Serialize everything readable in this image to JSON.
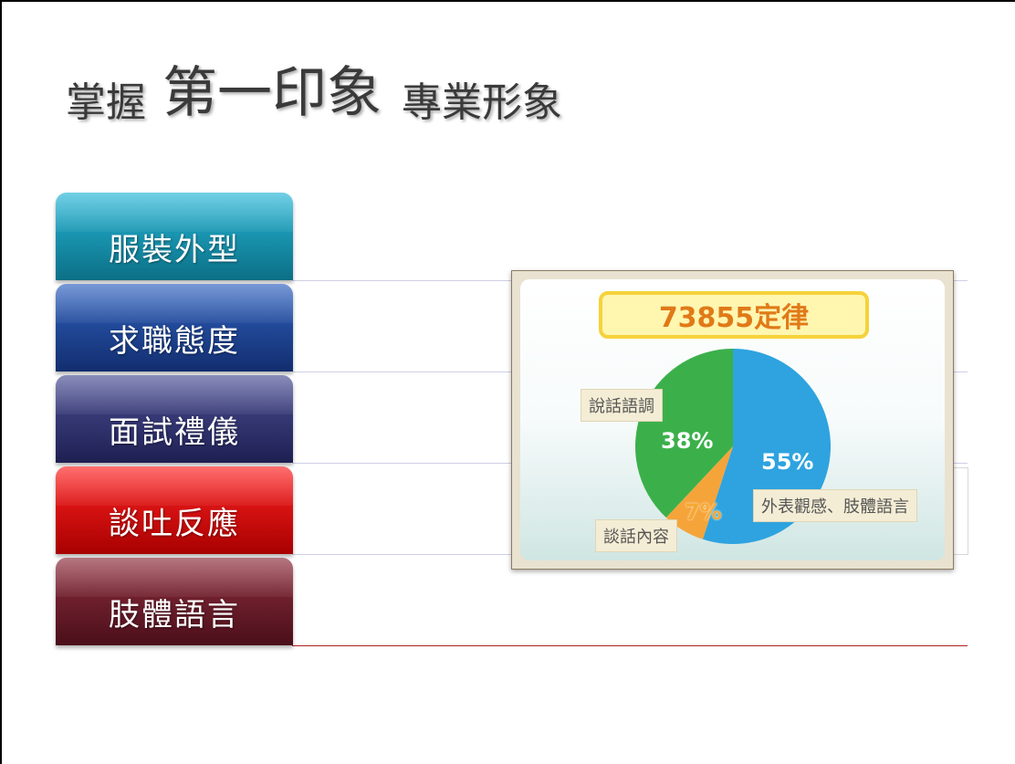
{
  "title": {
    "part1": "掌握",
    "part2": "第一印象",
    "part3": "專業形象"
  },
  "tiles": [
    {
      "label": "服裝外型",
      "color": "#1a93b0"
    },
    {
      "label": "求職態度",
      "color": "#1f469a"
    },
    {
      "label": "面試禮儀",
      "color": "#323672"
    },
    {
      "label": "談吐反應",
      "color": "#e00b0b"
    },
    {
      "label": "肢體語言",
      "color": "#6e1e2c"
    }
  ],
  "chart": {
    "title": "73855定律",
    "chart_data": {
      "type": "pie",
      "title": "73855定律",
      "categories": [
        "外表觀感、肢體語言",
        "說話語調",
        "談話內容"
      ],
      "values": [
        55,
        38,
        7
      ],
      "value_labels": [
        "55%",
        "38%",
        "7%"
      ],
      "colors": [
        "#2ea3df",
        "#3bb04a",
        "#f5a43a"
      ]
    },
    "labels": {
      "appearance": "外表觀感、肢體語言",
      "tone": "說話語調",
      "content": "談話內容"
    },
    "percents": {
      "appearance": "55%",
      "tone": "38%",
      "content": "7%"
    }
  }
}
